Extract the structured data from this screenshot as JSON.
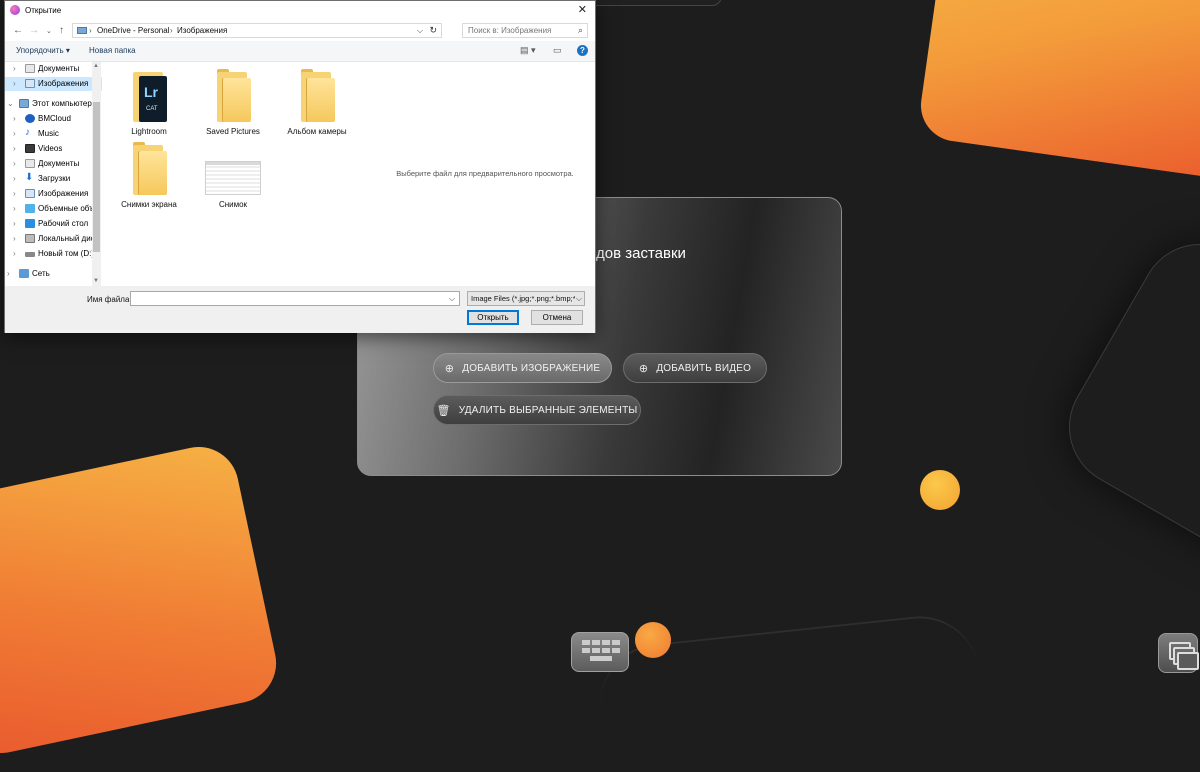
{
  "dialog": {
    "title": "Открытие",
    "address": {
      "segments": [
        "OneDrive - Personal",
        "Изображения"
      ],
      "separator": "›"
    },
    "search_placeholder": "Поиск в: Изображения",
    "toolbar": {
      "organize": "Упорядочить ▾",
      "new_folder": "Новая папка",
      "help": "?"
    },
    "nav": [
      {
        "label": "Документы",
        "icon": "documents-icon"
      },
      {
        "label": "Изображения",
        "icon": "pictures-icon"
      },
      {
        "label": "Этот компьютер",
        "icon": "computer-icon"
      },
      {
        "label": "BMCloud",
        "icon": "cloud-icon"
      },
      {
        "label": "Music",
        "icon": "music-icon"
      },
      {
        "label": "Videos",
        "icon": "videos-icon"
      },
      {
        "label": "Документы",
        "icon": "documents-icon"
      },
      {
        "label": "Загрузки",
        "icon": "downloads-icon"
      },
      {
        "label": "Изображения",
        "icon": "pictures-icon"
      },
      {
        "label": "Объемные объ",
        "icon": "3d-objects-icon"
      },
      {
        "label": "Рабочий стол",
        "icon": "desktop-icon"
      },
      {
        "label": "Локальный дис",
        "icon": "local-disk-icon"
      },
      {
        "label": "Новый том (D:)",
        "icon": "drive-icon"
      },
      {
        "label": "Сеть",
        "icon": "network-icon"
      }
    ],
    "files": [
      {
        "name": "Lightroom",
        "kind": "lightroom-folder"
      },
      {
        "name": "Saved Pictures",
        "kind": "folder"
      },
      {
        "name": "Альбом камеры",
        "kind": "folder"
      },
      {
        "name": "Снимки экрана",
        "kind": "folder"
      },
      {
        "name": "Снимок",
        "kind": "image"
      }
    ],
    "lightroom_badge": "Lr",
    "lightroom_sub": "CAT",
    "preview_message": "Выберите файл для предварительного просмотра.",
    "filename_label": "Имя файла:",
    "filename_value": "",
    "file_type_filter": "Image Files (*.jpg;*.png;*.bmp;*",
    "open_button": "Открыть",
    "cancel_button": "Отмена"
  },
  "app": {
    "panel_title": "дов заставки",
    "add_image": "ДОБАВИТЬ ИЗОБРАЖЕНИЕ",
    "add_video": "ДОБАВИТЬ ВИДЕО",
    "delete_selected": "УДАЛИТЬ ВЫБРАННЫЕ ЭЛЕМЕНТЫ"
  },
  "colors": {
    "accent_orange": "#f39a3a",
    "accent_yellow": "#fbc94a",
    "background": "#1d1d1d",
    "selection": "#cce8ff"
  }
}
